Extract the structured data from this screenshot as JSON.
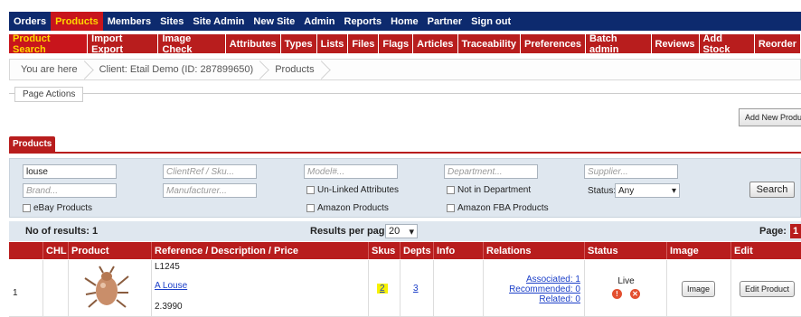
{
  "top_nav": {
    "items": [
      "Orders",
      "Products",
      "Members",
      "Sites",
      "Site Admin",
      "New Site",
      "Admin",
      "Reports",
      "Home",
      "Partner",
      "Sign out"
    ],
    "active_index": 1
  },
  "sub_nav": {
    "items": [
      "Product Search",
      "Import Export",
      "Image Check",
      "Attributes",
      "Types",
      "Lists",
      "Files",
      "Flags",
      "Articles",
      "Traceability",
      "Preferences",
      "Batch admin",
      "Reviews",
      "Add Stock",
      "Reorder"
    ],
    "active_index": 0
  },
  "breadcrumb": [
    "You are here",
    "Client: Etail Demo (ID: 287899650)",
    "Products"
  ],
  "page_actions": {
    "legend": "Page Actions",
    "add_new": "Add New Product"
  },
  "products_tab": "Products",
  "filters": {
    "search_value": "louse",
    "clientref_ph": "ClientRef / Sku...",
    "model_ph": "Model#...",
    "department_ph": "Department...",
    "supplier_ph": "Supplier...",
    "brand_ph": "Brand...",
    "manufacturer_ph": "Manufacturer...",
    "unlinked": "Un-Linked Attributes",
    "not_in_dept": "Not in Department",
    "status_label": "Status:",
    "status_value": "Any",
    "ebay": "eBay Products",
    "amazon": "Amazon Products",
    "amazon_fba": "Amazon FBA Products",
    "search_button": "Search"
  },
  "results": {
    "count_label": "No of results: 1",
    "per_page_label": "Results per page:",
    "per_page_value": "20",
    "page_label": "Page:",
    "page_number": "1"
  },
  "table": {
    "headers": [
      "",
      "CHL",
      "Product",
      "Reference / Description / Price",
      "Skus",
      "Depts",
      "Info",
      "Relations",
      "Status",
      "Image",
      "Edit"
    ],
    "row": {
      "index": "1",
      "reference": "L1245",
      "description": "A Louse",
      "price": "2.3990",
      "skus": "2",
      "depts": "3",
      "associated": "Associated: 1",
      "recommended": "Recommended: 0",
      "related": "Related: 0",
      "status": "Live",
      "image_button": "Image",
      "edit_button": "Edit Product"
    }
  },
  "colors": {
    "nav_blue": "#0d2a6e",
    "brand_red": "#b81d1d",
    "active_yellow": "#ffd700",
    "panel": "#dfe7ef"
  }
}
